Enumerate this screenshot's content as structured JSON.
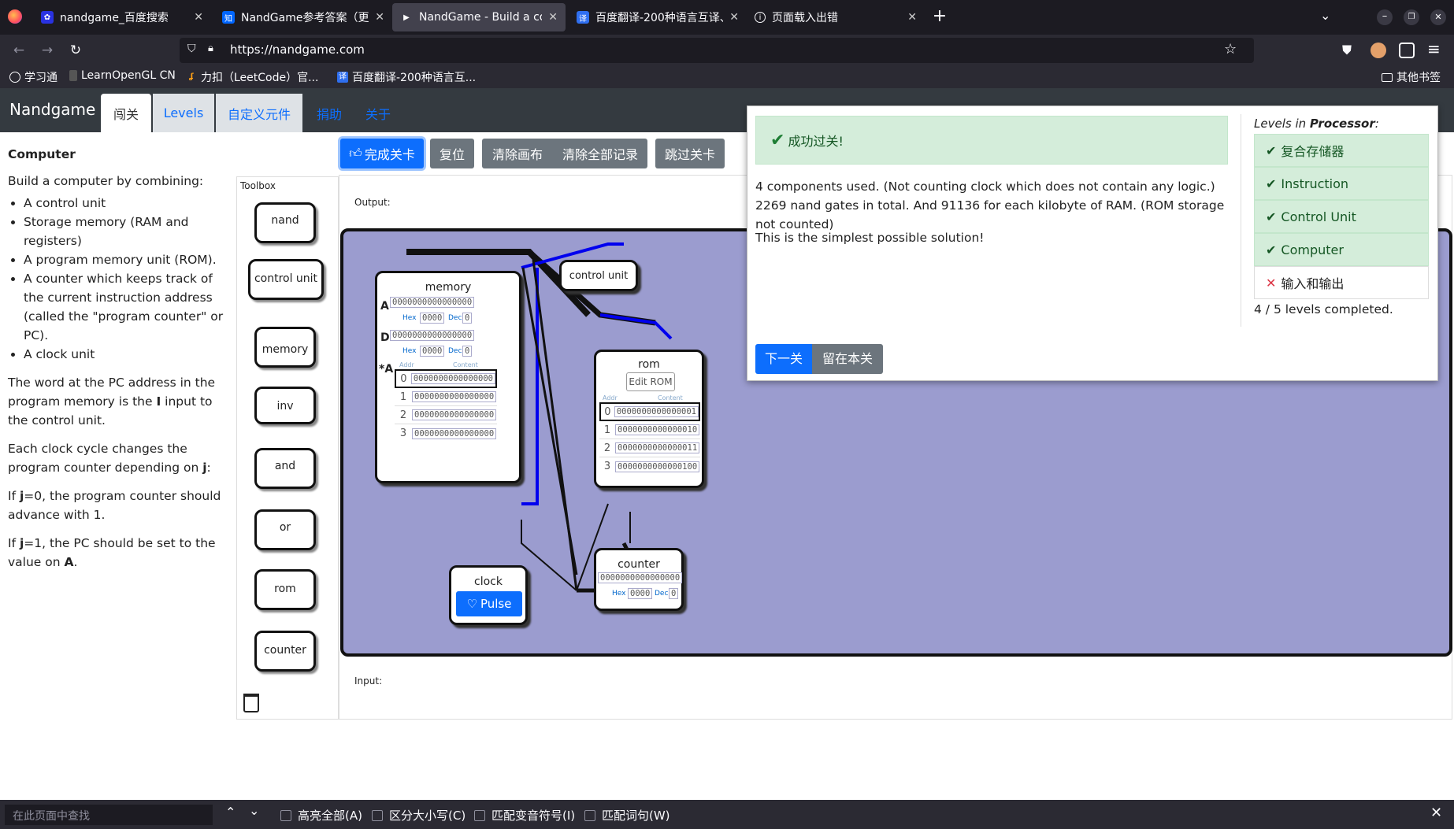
{
  "browser": {
    "tabs": [
      {
        "title": "nandgame_百度搜索",
        "icon": "baidu-icon",
        "active": false
      },
      {
        "title": "NandGame参考答案（更新",
        "icon": "zhihu-icon",
        "active": false
      },
      {
        "title": "NandGame - Build a comp",
        "icon": "nandgame-icon",
        "active": true
      },
      {
        "title": "百度翻译-200种语言互译、",
        "icon": "baidu-translate-icon",
        "active": false
      },
      {
        "title": "页面载入出错",
        "icon": "info-icon",
        "active": false
      }
    ],
    "url": "https://nandgame.com",
    "bookmarks": [
      {
        "label": "学习通",
        "icon": "globe-icon"
      },
      {
        "label": "LearnOpenGL CN",
        "icon": "bookmark-icon"
      },
      {
        "label": "力扣（LeetCode）官...",
        "icon": "leetcode-icon"
      },
      {
        "label": "百度翻译-200种语言互...",
        "icon": "baidu-translate-icon"
      }
    ],
    "other_bookmarks": "其他书签"
  },
  "app": {
    "brand": "Nandgame",
    "nav": [
      "闯关",
      "Levels",
      "自定义元件",
      "捐助",
      "关于"
    ]
  },
  "left": {
    "title": "Computer",
    "intro": "Build a computer by combining:",
    "bullets": [
      "A control unit",
      "Storage memory (RAM and registers)",
      "A program memory unit (ROM).",
      "A counter which keeps track of the current instruction address (called the \"program counter\" or PC).",
      "A clock unit"
    ],
    "p2_a": "The word at the PC address in the program memory is the ",
    "p2_b": "I",
    "p2_c": " input to the control unit.",
    "p3_a": "Each clock cycle changes the program counter depending on ",
    "p3_b": "j",
    "p3_c": ":",
    "p4_a": "If ",
    "p4_b": "j",
    "p4_c": "=0, the program counter should advance with 1.",
    "p5_a": "If ",
    "p5_b": "j",
    "p5_c": "=1, the PC should be set to the value on ",
    "p5_d": "A",
    "p5_e": "."
  },
  "toolbar": {
    "complete": "完成关卡",
    "reset": "复位",
    "clear_canvas": "清除画布",
    "clear_all": "清除全部记录",
    "skip": "跳过关卡"
  },
  "toolbox": {
    "label": "Toolbox",
    "items": [
      "nand",
      "control unit",
      "memory",
      "inv",
      "and",
      "or",
      "rom",
      "counter"
    ]
  },
  "canvas": {
    "output_label": "Output:",
    "input_label": "Input:",
    "memory": {
      "title": "memory",
      "A": "A",
      "D": "D",
      "starA": "*A",
      "a_bits": "0000000000000000",
      "d_bits": "0000000000000000",
      "hex": "Hex",
      "hex_val": "0000",
      "dec": "Dec",
      "dec_val": "0",
      "addr": "Addr",
      "content": "Content",
      "rows": [
        {
          "addr": "0",
          "val": "0000000000000000"
        },
        {
          "addr": "1",
          "val": "0000000000000000"
        },
        {
          "addr": "2",
          "val": "0000000000000000"
        },
        {
          "addr": "3",
          "val": "0000000000000000"
        }
      ]
    },
    "control": {
      "title": "control unit"
    },
    "rom": {
      "title": "rom",
      "edit": "Edit ROM",
      "addr": "Addr",
      "content": "Content",
      "rows": [
        {
          "addr": "0",
          "val": "0000000000000001"
        },
        {
          "addr": "1",
          "val": "0000000000000010"
        },
        {
          "addr": "2",
          "val": "0000000000000011"
        },
        {
          "addr": "3",
          "val": "0000000000000100"
        }
      ]
    },
    "clock": {
      "title": "clock",
      "pulse": "Pulse"
    },
    "counter": {
      "title": "counter",
      "bits": "0000000000000000",
      "hex": "Hex",
      "hex_val": "0000",
      "dec": "Dec",
      "dec_val": "0"
    }
  },
  "popup": {
    "success": "成功过关!",
    "summary": "4 components used. (Not counting clock which does not contain any logic.) 2269 nand gates in total. And 91136 for each kilobyte of RAM. (ROM storage not counted)",
    "note": "This is the simplest possible solution!",
    "next": "下一关",
    "stay": "留在本关",
    "levels_in": "Levels in ",
    "levels_group": "Processor",
    "levels": [
      {
        "name": "复合存储器",
        "done": true
      },
      {
        "name": "Instruction",
        "done": true
      },
      {
        "name": "Control Unit",
        "done": true
      },
      {
        "name": "Computer",
        "done": true
      },
      {
        "name": "输入和输出",
        "done": false
      }
    ],
    "progress": "4 / 5 levels completed."
  },
  "findbar": {
    "placeholder": "在此页面中查找",
    "highlight_all": "高亮全部(A)",
    "match_case": "区分大小写(C)",
    "match_diacritics": "匹配变音符号(I)",
    "whole_words": "匹配词句(W)"
  },
  "colors": {
    "primary": "#0d6efd",
    "success_bg": "#d4edda",
    "canvas": "#9b9ccf",
    "header": "#343a40"
  }
}
